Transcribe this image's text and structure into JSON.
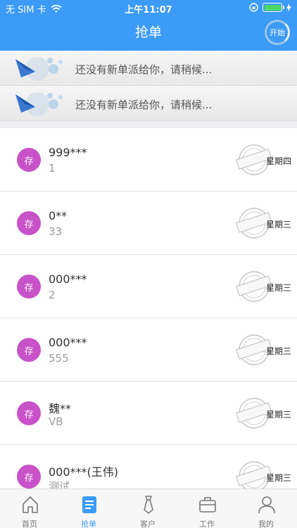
{
  "status_bar": {
    "carrier": "无 SIM 卡",
    "time": "上午11:07"
  },
  "header": {
    "title": "抢单",
    "start_label": "开始"
  },
  "banners": [
    {
      "text": "还没有新单派给你，请稍候..."
    },
    {
      "text": "还没有新单派给你，请稍候..."
    }
  ],
  "orders": [
    {
      "badge": "存",
      "title": "999***",
      "subtitle": "1",
      "weekday": "星期四"
    },
    {
      "badge": "存",
      "title": "0**",
      "subtitle": "33",
      "weekday": "星期三"
    },
    {
      "badge": "存",
      "title": "000***",
      "subtitle": "2",
      "weekday": "星期三"
    },
    {
      "badge": "存",
      "title": "000***",
      "subtitle": "555",
      "weekday": "星期三"
    },
    {
      "badge": "存",
      "title": "魏**",
      "subtitle": "VB",
      "weekday": "星期三"
    },
    {
      "badge": "存",
      "title": "000***(王伟)",
      "subtitle": "测试",
      "weekday": "星期三"
    }
  ],
  "tabbar": {
    "items": [
      {
        "label": "首页",
        "icon": "home-icon"
      },
      {
        "label": "抢单",
        "icon": "document-icon"
      },
      {
        "label": "客户",
        "icon": "tie-icon"
      },
      {
        "label": "工作",
        "icon": "briefcase-icon"
      },
      {
        "label": "我的",
        "icon": "user-icon"
      }
    ],
    "active_index": 1
  },
  "colors": {
    "primary": "#3b9bf6",
    "badge": "#c852c8",
    "battery": "#4cd964"
  }
}
